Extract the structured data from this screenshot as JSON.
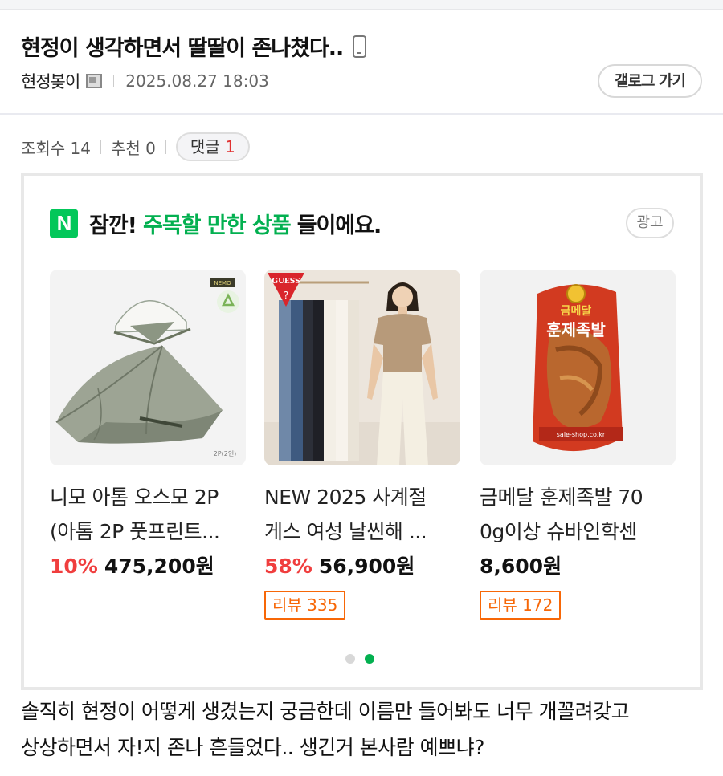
{
  "post": {
    "title": "현정이 생각하면서 딸딸이 존나쳤다..",
    "author": "현정봊이",
    "date": "2025.08.27 18:03",
    "gallery_button": "갤로그 가기",
    "views_label": "조회수 14",
    "recommend_label": "추천 0",
    "comments_label": "댓글",
    "comments_count": "1",
    "body_lines": [
      "솔직히 현정이 어떻게 생겼는지 궁금한데 이름만 들어봐도 너무 개꼴려갖고",
      "상상하면서 자!지 존나 흔들었다.. 생긴거 본사람 예쁘냐?"
    ]
  },
  "ad": {
    "logo": "N",
    "heading_prefix": "잠깐!",
    "heading_highlight": "주목할 만한 상품",
    "heading_suffix": "들이에요.",
    "badge": "광고",
    "products": [
      {
        "name_line1": "니모 아톰 오스모 2P",
        "name_line2": "(아톰 2P 풋프린트...",
        "discount": "10%",
        "price": "475,200원",
        "review": ""
      },
      {
        "name_line1": "NEW 2025 사계절",
        "name_line2": "게스 여성 날씬해 ...",
        "discount": "58%",
        "price": "56,900원",
        "review": "리뷰 335"
      },
      {
        "name_line1": "금메달 훈제족발 70",
        "name_line2": "0g이상 슈바인학센",
        "discount": "",
        "price": "8,600원",
        "review": "리뷰 172"
      }
    ],
    "tent_brand": "NEMO",
    "tent_label": "2P(2인)",
    "jeans_brand": "GUESS",
    "food_brand": "금메달",
    "food_name": "훈제족발",
    "carousel_active_index": 1,
    "colors": {
      "accent_green": "#03b050",
      "discount_red": "#f03e3e",
      "review_orange": "#f76707"
    }
  }
}
